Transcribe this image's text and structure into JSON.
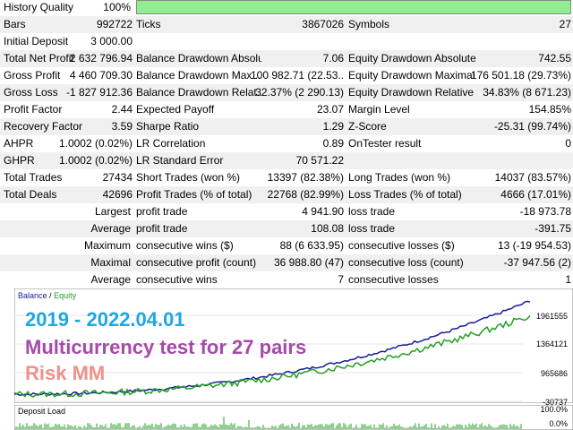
{
  "history_quality": {
    "label": "History Quality",
    "value": "100%",
    "fraction": 1.0
  },
  "rows": [
    {
      "l1": "Bars",
      "v1": "992722",
      "l2": "Ticks",
      "v2": "3867026",
      "l3": "Symbols",
      "v3": "27"
    },
    {
      "l1": "Initial Deposit",
      "v1": "3 000.00",
      "l2": "",
      "v2": "",
      "l3": "",
      "v3": ""
    },
    {
      "l1": "Total Net Profit",
      "v1": "2 632 796.94",
      "l2": "Balance Drawdown Absolute",
      "v2": "7.06",
      "l3": "Equity Drawdown Absolute",
      "v3": "742.55"
    },
    {
      "l1": "Gross Profit",
      "v1": "4 460 709.30",
      "l2": "Balance Drawdown Max...",
      "v2": "100 982.71 (22.53...",
      "l3": "Equity Drawdown Maximal",
      "v3": "176 501.18 (29.73%)"
    },
    {
      "l1": "Gross Loss",
      "v1": "-1 827 912.36",
      "l2": "Balance Drawdown Relat...",
      "v2": "32.37% (2 290.13)",
      "l3": "Equity Drawdown Relative",
      "v3": "34.83% (8 671.23)"
    },
    {
      "l1": "Profit Factor",
      "v1": "2.44",
      "l2": "Expected Payoff",
      "v2": "23.07",
      "l3": "Margin Level",
      "v3": "154.85%"
    },
    {
      "l1": "Recovery Factor",
      "v1": "3.59",
      "l2": "Sharpe Ratio",
      "v2": "1.29",
      "l3": "Z-Score",
      "v3": "-25.31 (99.74%)"
    },
    {
      "l1": "AHPR",
      "v1": "1.0002 (0.02%)",
      "l2": "LR Correlation",
      "v2": "0.89",
      "l3": "OnTester result",
      "v3": "0"
    },
    {
      "l1": "GHPR",
      "v1": "1.0002 (0.02%)",
      "l2": "LR Standard Error",
      "v2": "70 571.22",
      "l3": "",
      "v3": ""
    },
    {
      "l1": "Total Trades",
      "v1": "27434",
      "l2": "Short Trades (won %)",
      "v2": "13397 (82.38%)",
      "l3": "Long Trades (won %)",
      "v3": "14037 (83.57%)"
    },
    {
      "l1": "Total Deals",
      "v1": "42696",
      "l2": "Profit Trades (% of total)",
      "v2": "22768 (82.99%)",
      "l3": "Loss Trades (% of total)",
      "v3": "4666 (17.01%)"
    },
    {
      "l1": "",
      "v1": "Largest",
      "l2": "profit trade",
      "v2": "4 941.90",
      "l3": "loss trade",
      "v3": "-18 973.78"
    },
    {
      "l1": "",
      "v1": "Average",
      "l2": "profit trade",
      "v2": "108.08",
      "l3": "loss trade",
      "v3": "-391.75"
    },
    {
      "l1": "",
      "v1": "Maximum",
      "l2": "consecutive wins ($)",
      "v2": "88 (6 633.95)",
      "l3": "consecutive losses ($)",
      "v3": "13 (-19 954.53)"
    },
    {
      "l1": "",
      "v1": "Maximal",
      "l2": "consecutive profit (count)",
      "v2": "36 988.80 (47)",
      "l3": "consecutive loss (count)",
      "v3": "-37 947.56 (2)"
    },
    {
      "l1": "",
      "v1": "Average",
      "l2": "consecutive wins",
      "v2": "7",
      "l3": "consecutive losses",
      "v3": "1"
    }
  ],
  "chart": {
    "legend_balance": "Balance",
    "legend_sep": "/",
    "legend_equity": "Equity",
    "y_ticks": [
      "1961555",
      "1364121",
      "965686",
      "-30737"
    ],
    "overlay_line1": "2019 - 2022.04.01",
    "overlay_line2": "Multicurrency test for 27 pairs",
    "overlay_line3": "Risk MM",
    "balance_color": "#1a1a9c",
    "equity_color": "#22a022"
  },
  "deposit_load": {
    "title": "Deposit Load",
    "y_ticks": [
      "100.0%",
      "0.0%"
    ],
    "color": "#22a022"
  }
}
